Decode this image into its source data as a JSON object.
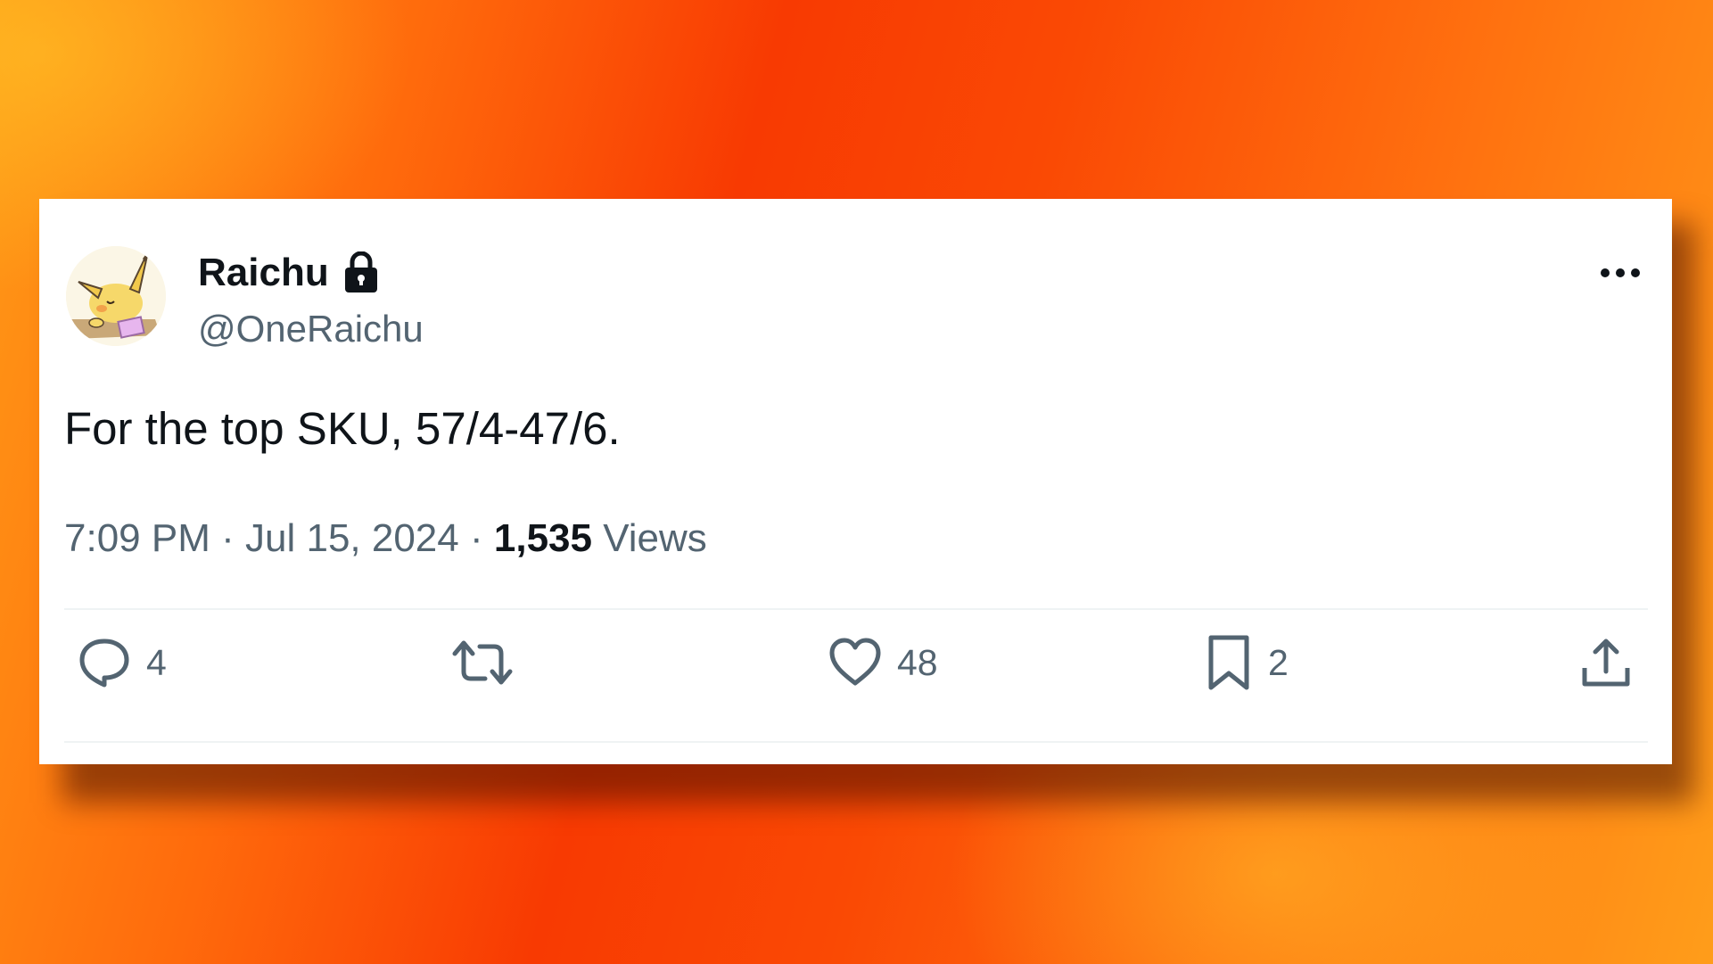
{
  "tweet": {
    "display_name": "Raichu",
    "handle": "@OneRaichu",
    "text": "For the top SKU, 57/4-47/6.",
    "time": "7:09 PM",
    "separator": "·",
    "date": "Jul 15, 2024",
    "views_count": "1,535",
    "views_label": "Views",
    "protected_icon": "lock-icon",
    "avatar_icon": "raichu-avatar"
  },
  "actions": {
    "replies": "4",
    "retweets": "",
    "likes": "48",
    "bookmarks": "2"
  },
  "colors": {
    "text_primary": "#0f1419",
    "text_secondary": "#536471",
    "divider": "#eff3f4",
    "background_orange": "#f83a02"
  }
}
